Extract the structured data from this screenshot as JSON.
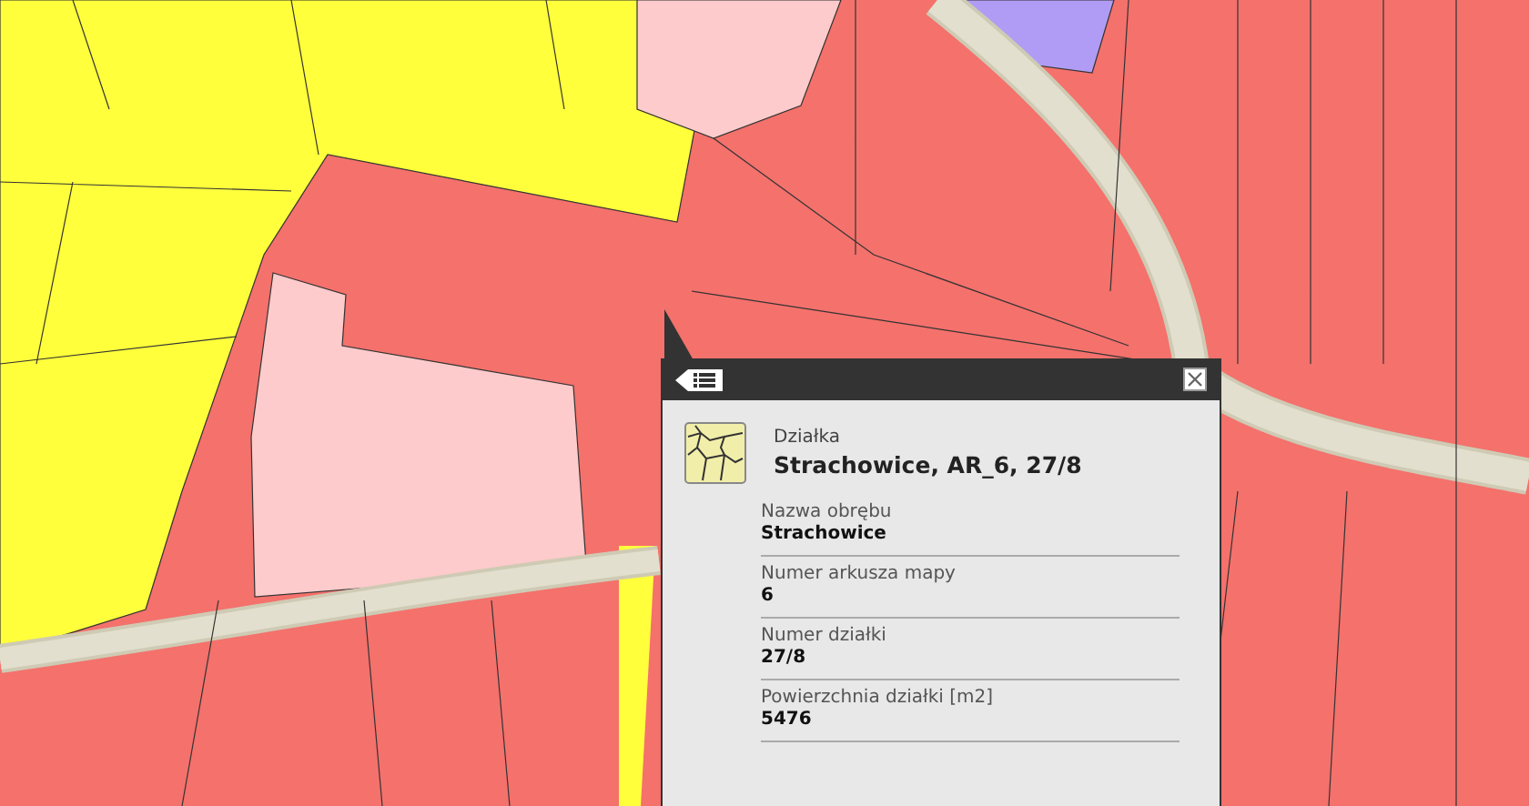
{
  "popup": {
    "category": "Działka",
    "title": "Strachowice, AR_6, 27/8",
    "fields": [
      {
        "label": "Nazwa obrębu",
        "value": "Strachowice"
      },
      {
        "label": "Numer arkusza mapy",
        "value": "6"
      },
      {
        "label": "Numer działki",
        "value": "27/8"
      },
      {
        "label": "Powierzchnia działki [m2]",
        "value": "5476"
      }
    ]
  }
}
